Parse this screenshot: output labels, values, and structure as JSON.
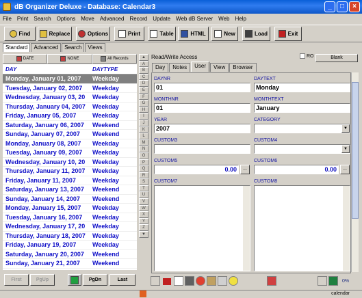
{
  "window": {
    "title": "dB Organizer Deluxe - Database: Calendar3"
  },
  "menu": [
    "File",
    "Print",
    "Search",
    "Options",
    "Move",
    "Advanced",
    "Record",
    "Update",
    "Web dB Server",
    "Web",
    "Help"
  ],
  "toolbar": {
    "find": "Find",
    "replace": "Replace",
    "options": "Options",
    "print": "Print",
    "table": "Table",
    "html": "HTML",
    "new": "New",
    "load": "Load",
    "exit": "Exit"
  },
  "left_tabs": [
    "Standard",
    "Advanced",
    "Search",
    "Views"
  ],
  "sort_buttons": [
    "DATE",
    "NONE",
    "All Records"
  ],
  "grid": {
    "headers": [
      "DAY",
      "DAYTYPE"
    ],
    "rows": [
      [
        "Monday, January 01, 2007",
        "Weekday"
      ],
      [
        "Tuesday, January 02, 2007",
        "Weekday"
      ],
      [
        "Wednesday, January 03, 20",
        "Weekday"
      ],
      [
        "Thursday, January 04, 2007",
        "Weekday"
      ],
      [
        "Friday, January 05, 2007",
        "Weekday"
      ],
      [
        "Saturday, January 06, 2007",
        "Weekend"
      ],
      [
        "Sunday, January 07, 2007",
        "Weekend"
      ],
      [
        "Monday, January 08, 2007",
        "Weekday"
      ],
      [
        "Tuesday, January 09, 2007",
        "Weekday"
      ],
      [
        "Wednesday, January 10, 20",
        "Weekday"
      ],
      [
        "Thursday, January 11, 2007",
        "Weekday"
      ],
      [
        "Friday, January 11, 2007",
        "Weekday"
      ],
      [
        "Saturday, January 13, 2007",
        "Weekend"
      ],
      [
        "Sunday, January 14, 2007",
        "Weekend"
      ],
      [
        "Monday, January 15, 2007",
        "Weekday"
      ],
      [
        "Tuesday, January 16, 2007",
        "Weekday"
      ],
      [
        "Wednesday, January 17, 20",
        "Weekday"
      ],
      [
        "Thursday, January 18, 2007",
        "Weekday"
      ],
      [
        "Friday, January 19, 2007",
        "Weekday"
      ],
      [
        "Saturday, January 20, 2007",
        "Weekend"
      ],
      [
        "Sunday, January 21, 2007",
        "Weekend"
      ]
    ]
  },
  "nav": {
    "first": "First",
    "pgup": "PgUp",
    "pgdn": "PgDn",
    "last": "Last"
  },
  "alphabet": [
    "A",
    "B",
    "C",
    "D",
    "E",
    "F",
    "G",
    "H",
    "I",
    "J",
    "K",
    "L",
    "M",
    "N",
    "O",
    "P",
    "Q",
    "R",
    "S",
    "T",
    "U",
    "V",
    "W",
    "X",
    "Y",
    "Z"
  ],
  "right": {
    "access": "Read/Write Access",
    "ro": "RO",
    "blank": "Blank",
    "tabs": [
      "Day",
      "Notes",
      "User",
      "View",
      "Browser"
    ],
    "fields": {
      "daynr": {
        "label": "DAYNR",
        "value": "01"
      },
      "daytext": {
        "label": "DAYTEXT",
        "value": "Monday"
      },
      "monthnr": {
        "label": "MONTHNR",
        "value": "01"
      },
      "monthtext": {
        "label": "MONTHTEXT",
        "value": "January"
      },
      "year": {
        "label": "YEAR",
        "value": "2007"
      },
      "category": {
        "label": "CATEGORY",
        "value": ""
      },
      "custom3": {
        "label": "CUSTOM3",
        "value": ""
      },
      "custom4": {
        "label": "CUSTOM4",
        "value": ""
      },
      "custom5": {
        "label": "CUSTOM5",
        "value": "0.00"
      },
      "custom6": {
        "label": "CUSTOM6",
        "value": "0.00"
      },
      "custom7": {
        "label": "CUSTOM7"
      },
      "custom8": {
        "label": "CUSTOM8"
      }
    },
    "ellipsis": "...",
    "percent": "0%"
  },
  "status": {
    "db": "calendar"
  }
}
